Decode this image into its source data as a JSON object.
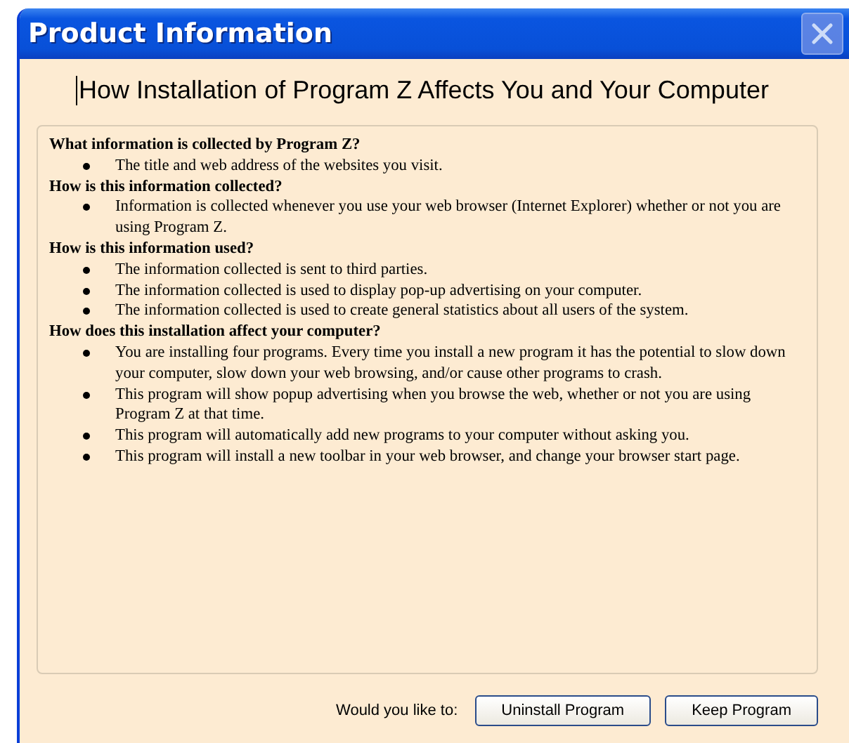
{
  "window": {
    "title": "Product Information"
  },
  "heading": "How Installation of Program Z Affects You and Your Computer",
  "sections": [
    {
      "question": "What information is collected by Program Z?",
      "items": [
        "The title and web address of the websites you visit."
      ]
    },
    {
      "question": "How is this information collected?",
      "items": [
        "Information is collected whenever you use your web browser (Internet Explorer) whether or not you are using Program Z."
      ]
    },
    {
      "question": "How is this information used?",
      "items": [
        "The information collected is sent to third parties.",
        "The information collected is used to display pop-up advertising on your computer.",
        "The information collected is used to create general statistics about all users of the system."
      ]
    },
    {
      "question": "How does this installation affect your computer?",
      "items": [
        "You are installing four programs. Every time you install a new program it has the potential to slow down your computer, slow down your web browsing, and/or cause other programs to crash.",
        "This program will show popup advertising when you browse the web, whether or not you are using Program Z at that time.",
        "This program will automatically add new programs to your computer without asking you.",
        "This program will install a new toolbar in your web browser, and change your browser start page."
      ]
    }
  ],
  "prompt": "Would you like to:",
  "buttons": [
    "Uninstall Program",
    "Keep Program"
  ]
}
